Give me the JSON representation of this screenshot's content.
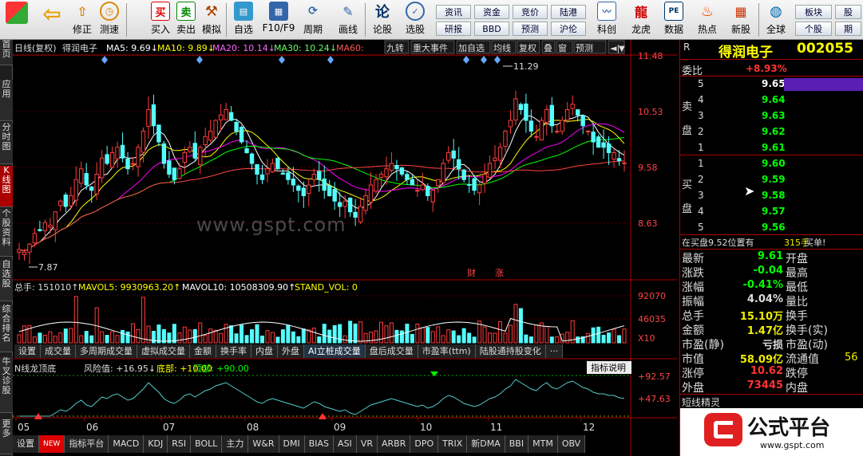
{
  "toolbar": {
    "buttons": [
      {
        "label": "修正",
        "icon": "up-arrow-icon"
      },
      {
        "label": "测速",
        "icon": "clock-icon"
      },
      {
        "label": "买入",
        "icon": "buy-icon"
      },
      {
        "label": "卖出",
        "icon": "sell-icon"
      },
      {
        "label": "模拟",
        "icon": "hammer-icon"
      },
      {
        "label": "自选",
        "icon": "folder-icon"
      },
      {
        "label": "F10/F9",
        "icon": "doc-icon"
      },
      {
        "label": "周期",
        "icon": "cycle-icon"
      },
      {
        "label": "画线",
        "icon": "pencil-icon"
      },
      {
        "label": "论股",
        "icon": "forum-icon"
      },
      {
        "label": "选股",
        "icon": "select-icon"
      },
      {
        "label": "科创",
        "icon": "chart-icon"
      },
      {
        "label": "龙虎",
        "icon": "dragon-icon"
      },
      {
        "label": "数据",
        "icon": "pe-icon"
      },
      {
        "label": "热点",
        "icon": "fire-icon"
      },
      {
        "label": "新股",
        "icon": "grid-icon"
      },
      {
        "label": "全球",
        "icon": "globe-icon"
      }
    ],
    "small": [
      "资讯",
      "资金",
      "竞价",
      "陆港",
      "研报",
      "BBD",
      "预测",
      "沪伦",
      "板块",
      "股",
      "个股",
      "期"
    ],
    "buy_glyph": "买",
    "sell_glyph": "卖",
    "forum_glyph": "论",
    "pe_glyph": "PE"
  },
  "left_tabs": [
    "首页",
    "应用",
    "分时图",
    "K线图",
    "个股资料",
    "自选股",
    "综合排名",
    "牛叉诊股",
    "更多"
  ],
  "chart": {
    "header": {
      "period": "日线(复权)",
      "name": "得润电子",
      "ma5": "MA5: 9.69↓",
      "ma10": "MA10: 9.89↓",
      "ma20": "MA20: 10.14↓",
      "ma30": "MA30: 10.24↓",
      "ma60": "MA60:"
    },
    "top_buttons": [
      "九转",
      "重大事件",
      "加自选",
      "均线",
      "复权",
      "叠",
      "窗",
      "预测",
      "◄|"
    ],
    "price_axis": [
      "11.48",
      "10.53",
      "9.58",
      "8.63"
    ],
    "high_label": "11.29",
    "low_label": "7.87",
    "event_labels": [
      "财",
      "涨"
    ],
    "watermark": "www.gspt.com",
    "volume_header": {
      "total": "总手: 151010↑",
      "mavol5": "MAVOL5: 9930963.20↑",
      "mavol10": "MAVOL10: 10508309.90↑",
      "stand": "STAND_VOL: 0"
    },
    "volume_axis": [
      "92070",
      "46035",
      "X10"
    ],
    "ind_tabs": [
      "设置",
      "成交量",
      "多周期成交量",
      "虚拟成交量",
      "金额",
      "换手率",
      "内盘",
      "外盘",
      "AI立桩成交量",
      "盘后成交量",
      "市盈率(ttm)",
      "陆股通持股变化",
      "···"
    ],
    "indicator_header": {
      "name": "N线龙顶底",
      "risk": "风险值: +16.95↓",
      "bottom": "底部: +10.00",
      "top": "顶部: +90.00"
    },
    "indicator_help": "指标说明",
    "indicator_axis": [
      "+92.57",
      "+47.63"
    ],
    "months": [
      "05",
      "06",
      "07",
      "08",
      "09",
      "10",
      "11",
      "12"
    ],
    "bottom_tabs": [
      "设置",
      "NEW",
      "指标平台",
      "MACD",
      "KDJ",
      "RSI",
      "BOLL",
      "主力",
      "W&R",
      "DMI",
      "BIAS",
      "ASI",
      "VR",
      "ARBR",
      "DPO",
      "TRIX",
      "新DMA",
      "BBI",
      "MTM",
      "OBV"
    ]
  },
  "quote": {
    "r": "R",
    "stock_name": "得润电子",
    "code": "002055",
    "weibi_label": "委比",
    "weibi_value": "+8.93%",
    "sell_label": "卖盘",
    "buy_label": "买盘",
    "asks": [
      {
        "lvl": "5",
        "price": "9.65"
      },
      {
        "lvl": "4",
        "price": "9.64"
      },
      {
        "lvl": "3",
        "price": "9.63"
      },
      {
        "lvl": "2",
        "price": "9.62"
      },
      {
        "lvl": "1",
        "price": "9.61"
      }
    ],
    "bids": [
      {
        "lvl": "1",
        "price": "9.60"
      },
      {
        "lvl": "2",
        "price": "9.59"
      },
      {
        "lvl": "3",
        "price": "9.58"
      },
      {
        "lvl": "4",
        "price": "9.57"
      },
      {
        "lvl": "5",
        "price": "9.56"
      }
    ],
    "notice": "在买盘9.52位置有",
    "notice_vol": "315手",
    "notice_action": "买单!",
    "stats": [
      {
        "l": "最新",
        "v": "9.61",
        "l2": "开盘",
        "c": "#0f0"
      },
      {
        "l": "涨跌",
        "v": "-0.04",
        "l2": "最高",
        "c": "#0f0"
      },
      {
        "l": "涨幅",
        "v": "-0.41%",
        "l2": "最低",
        "c": "#0f0"
      },
      {
        "l": "振幅",
        "v": "4.04%",
        "l2": "量比",
        "c": "#ddd"
      },
      {
        "l": "总手",
        "v": "15.10万",
        "l2": "换手",
        "c": "#ee0"
      },
      {
        "l": "金额",
        "v": "1.47亿",
        "l2": "换手(实)",
        "c": "#ee0"
      },
      {
        "l": "市盈(静)",
        "v": "亏损",
        "l2": "市盈(动)",
        "c": "#ddd"
      },
      {
        "l": "市值",
        "v": "58.09亿",
        "l2": "流通值",
        "c": "#ee0"
      },
      {
        "l": "涨停",
        "v": "10.62",
        "l2": "跌停",
        "c": "#f33"
      },
      {
        "l": "外盘",
        "v": "73445",
        "l2": "内盘",
        "c": "#f33"
      }
    ],
    "liutong_tail": "56",
    "short_label": "短线精灵",
    "logo_text": "公式平台",
    "logo_url": "www.gspt.com"
  },
  "colors": {
    "up": "#ff3c3c",
    "down": "#54ffff",
    "ma5": "#ffffff",
    "ma10": "#ffff00",
    "ma20": "#ff00ff",
    "ma30": "#00ff00",
    "purple": "#5a1eb4"
  },
  "chart_data": {
    "type": "candlestick",
    "x_months": [
      "05",
      "06",
      "07",
      "08",
      "09",
      "10",
      "11",
      "12"
    ],
    "ylim": [
      7.6,
      11.6
    ],
    "close": [
      8.0,
      7.95,
      8.1,
      8.3,
      8.35,
      8.5,
      8.45,
      8.7,
      8.9,
      8.8,
      9.0,
      9.3,
      9.5,
      9.2,
      9.1,
      9.4,
      9.7,
      9.6,
      9.8,
      9.9,
      9.7,
      9.5,
      9.6,
      9.9,
      10.2,
      10.6,
      10.3,
      10.0,
      9.6,
      9.4,
      9.3,
      9.5,
      9.8,
      9.9,
      9.7,
      9.9,
      10.1,
      10.2,
      10.4,
      10.5,
      10.6,
      10.4,
      10.2,
      10.0,
      9.8,
      9.6,
      9.4,
      9.3,
      9.5,
      9.6,
      9.5,
      9.4,
      9.3,
      9.2,
      9.1,
      9.0,
      9.2,
      9.4,
      9.3,
      9.1,
      9.0,
      8.9,
      8.8,
      8.9,
      8.7,
      8.6,
      8.8,
      9.0,
      9.2,
      9.3,
      9.4,
      9.5,
      9.6,
      9.5,
      9.4,
      9.3,
      9.2,
      9.1,
      9.2,
      9.0,
      9.1,
      9.3,
      9.6,
      9.8,
      9.7,
      9.5,
      9.3,
      9.2,
      9.1,
      9.2,
      9.4,
      9.6,
      9.7,
      9.9,
      10.2,
      10.4,
      10.8,
      10.6,
      10.4,
      10.2,
      10.1,
      10.4,
      10.6,
      10.3,
      10.2,
      10.4,
      10.6,
      10.7,
      10.5,
      10.3,
      10.2,
      10.0,
      9.9,
      9.9,
      9.8,
      9.8,
      9.65,
      9.61
    ],
    "volume_ylim": [
      0,
      92070
    ],
    "indicator": {
      "name": "N线龙顶底",
      "risk": 16.95,
      "bottom": 10.0,
      "top": 90.0
    }
  }
}
